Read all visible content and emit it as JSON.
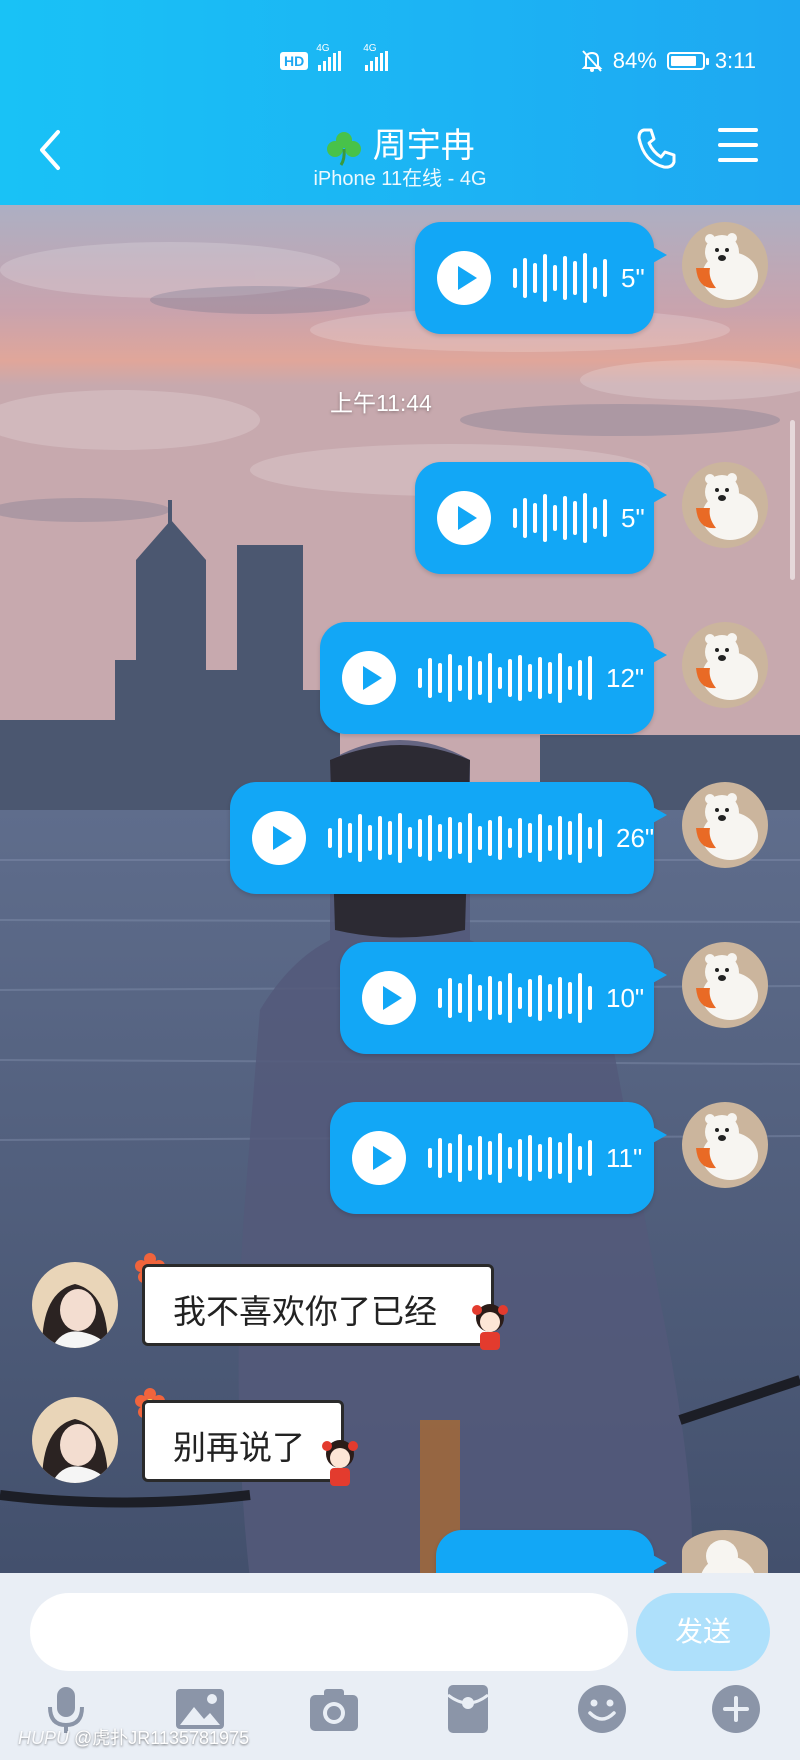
{
  "status_bar": {
    "network_badge": "HD",
    "signal_1": "4G",
    "signal_2": "4G",
    "battery_text": "84%",
    "battery_level": 0.84,
    "time": "3:11"
  },
  "header": {
    "contact_name": "周宇冉",
    "contact_status": "iPhone 11在线 - 4G",
    "icons": [
      "back-icon",
      "clover-icon",
      "phone-icon",
      "menu-icon"
    ]
  },
  "chat": {
    "timestamp": "上午11:44",
    "voice_messages": [
      {
        "duration": "5\""
      },
      {
        "duration": "5\""
      },
      {
        "duration": "12\""
      },
      {
        "duration": "26\""
      },
      {
        "duration": "10\""
      },
      {
        "duration": "11\""
      }
    ],
    "text_messages": [
      {
        "text": "我不喜欢你了已经"
      },
      {
        "text": "别再说了"
      }
    ]
  },
  "composer": {
    "input_value": "",
    "send_label": "发送",
    "tools": [
      "microphone-icon",
      "image-icon",
      "camera-icon",
      "red-packet-icon",
      "emoji-icon",
      "plus-icon"
    ]
  },
  "watermark": {
    "brand": "HUPU",
    "text": "@虎扑JR1135781975"
  },
  "colors": {
    "header_start": "#19c2f6",
    "header_end": "#1ea8f2",
    "bubble": "#12a7f6",
    "send_disabled": "#aee0fb"
  }
}
